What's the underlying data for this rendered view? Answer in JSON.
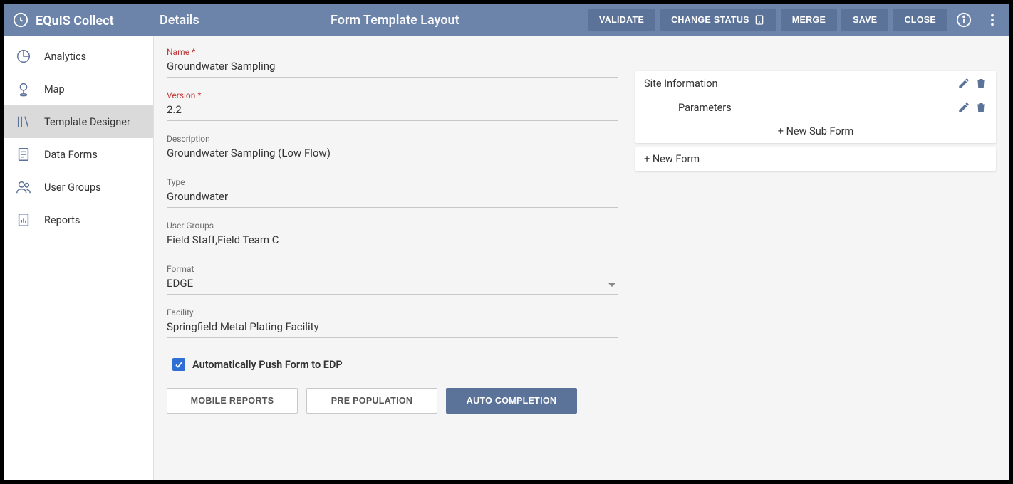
{
  "brand": {
    "name": "EQuIS Collect",
    "sub": ""
  },
  "header": {
    "details": "Details",
    "layout": "Form Template Layout",
    "buttons": {
      "validate": "VALIDATE",
      "change_status": "CHANGE STATUS",
      "merge": "MERGE",
      "save": "SAVE",
      "close": "CLOSE"
    }
  },
  "sidebar": {
    "items": [
      {
        "label": "Analytics"
      },
      {
        "label": "Map"
      },
      {
        "label": "Template Designer"
      },
      {
        "label": "Data Forms"
      },
      {
        "label": "User Groups"
      },
      {
        "label": "Reports"
      }
    ]
  },
  "fields": {
    "name": {
      "label": "Name",
      "value": "Groundwater Sampling"
    },
    "version": {
      "label": "Version",
      "value": "2.2"
    },
    "description": {
      "label": "Description",
      "value": "Groundwater Sampling (Low Flow)"
    },
    "type": {
      "label": "Type",
      "value": "Groundwater"
    },
    "user_groups": {
      "label": "User Groups",
      "value": "Field Staff,Field Team C"
    },
    "format": {
      "label": "Format",
      "value": "EDGE"
    },
    "facility": {
      "label": "Facility",
      "value": "Springfield Metal Plating Facility"
    }
  },
  "checkbox": {
    "label": "Automatically Push Form to EDP",
    "checked": true
  },
  "tabs": {
    "mobile_reports": "MOBILE REPORTS",
    "pre_population": "PRE POPULATION",
    "auto_completion": "AUTO COMPLETION"
  },
  "tree": {
    "root": {
      "label": "Site Information"
    },
    "child": {
      "label": "Parameters"
    },
    "new_sub": "+ New Sub Form",
    "new_form": "+ New Form"
  }
}
